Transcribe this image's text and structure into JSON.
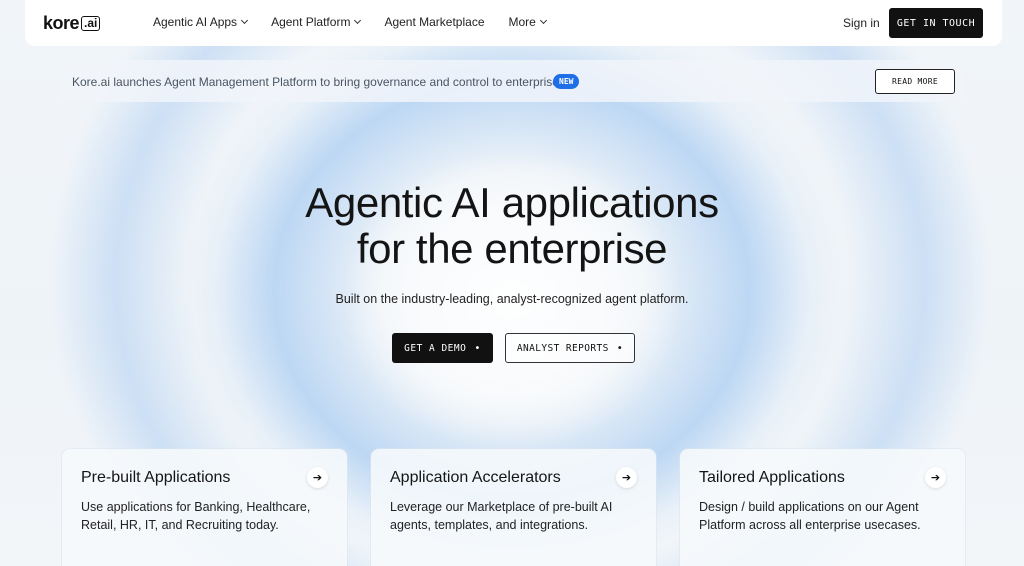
{
  "nav": {
    "logo_text": "kore",
    "logo_box": ".ai",
    "items": [
      {
        "label": "Agentic AI Apps",
        "has_dropdown": true
      },
      {
        "label": "Agent Platform",
        "has_dropdown": true
      },
      {
        "label": "Agent Marketplace",
        "has_dropdown": false
      },
      {
        "label": "More",
        "has_dropdown": true
      }
    ],
    "signin_label": "Sign in",
    "cta_label": "GET IN TOUCH"
  },
  "announcement": {
    "text": "Kore.ai launches Agent Management Platform to bring governance and control to enterprise AI",
    "badge": "NEW",
    "button_label": "READ MORE"
  },
  "hero": {
    "title_line1": "Agentic AI applications",
    "title_line2": "for the enterprise",
    "subtitle": "Built on the industry-leading, analyst-recognized agent platform.",
    "demo_label": "GET A DEMO",
    "reports_label": "ANALYST REPORTS",
    "bullet": "•"
  },
  "cards": [
    {
      "title": "Pre-built Applications",
      "text": "Use applications for Banking, Healthcare, Retail, HR, IT, and Recruiting today.",
      "arrow": "➔"
    },
    {
      "title": "Application Accelerators",
      "text": "Leverage our Marketplace of pre-built AI agents, templates, and integrations.",
      "arrow": "➔"
    },
    {
      "title": "Tailored Applications",
      "text": "Design / build applications on our Agent Platform across all enterprise usecases.",
      "arrow": "➔"
    }
  ],
  "colors": {
    "accent_dark": "#111111",
    "badge_blue": "#1e6ee8",
    "background": "#eef3f8"
  }
}
